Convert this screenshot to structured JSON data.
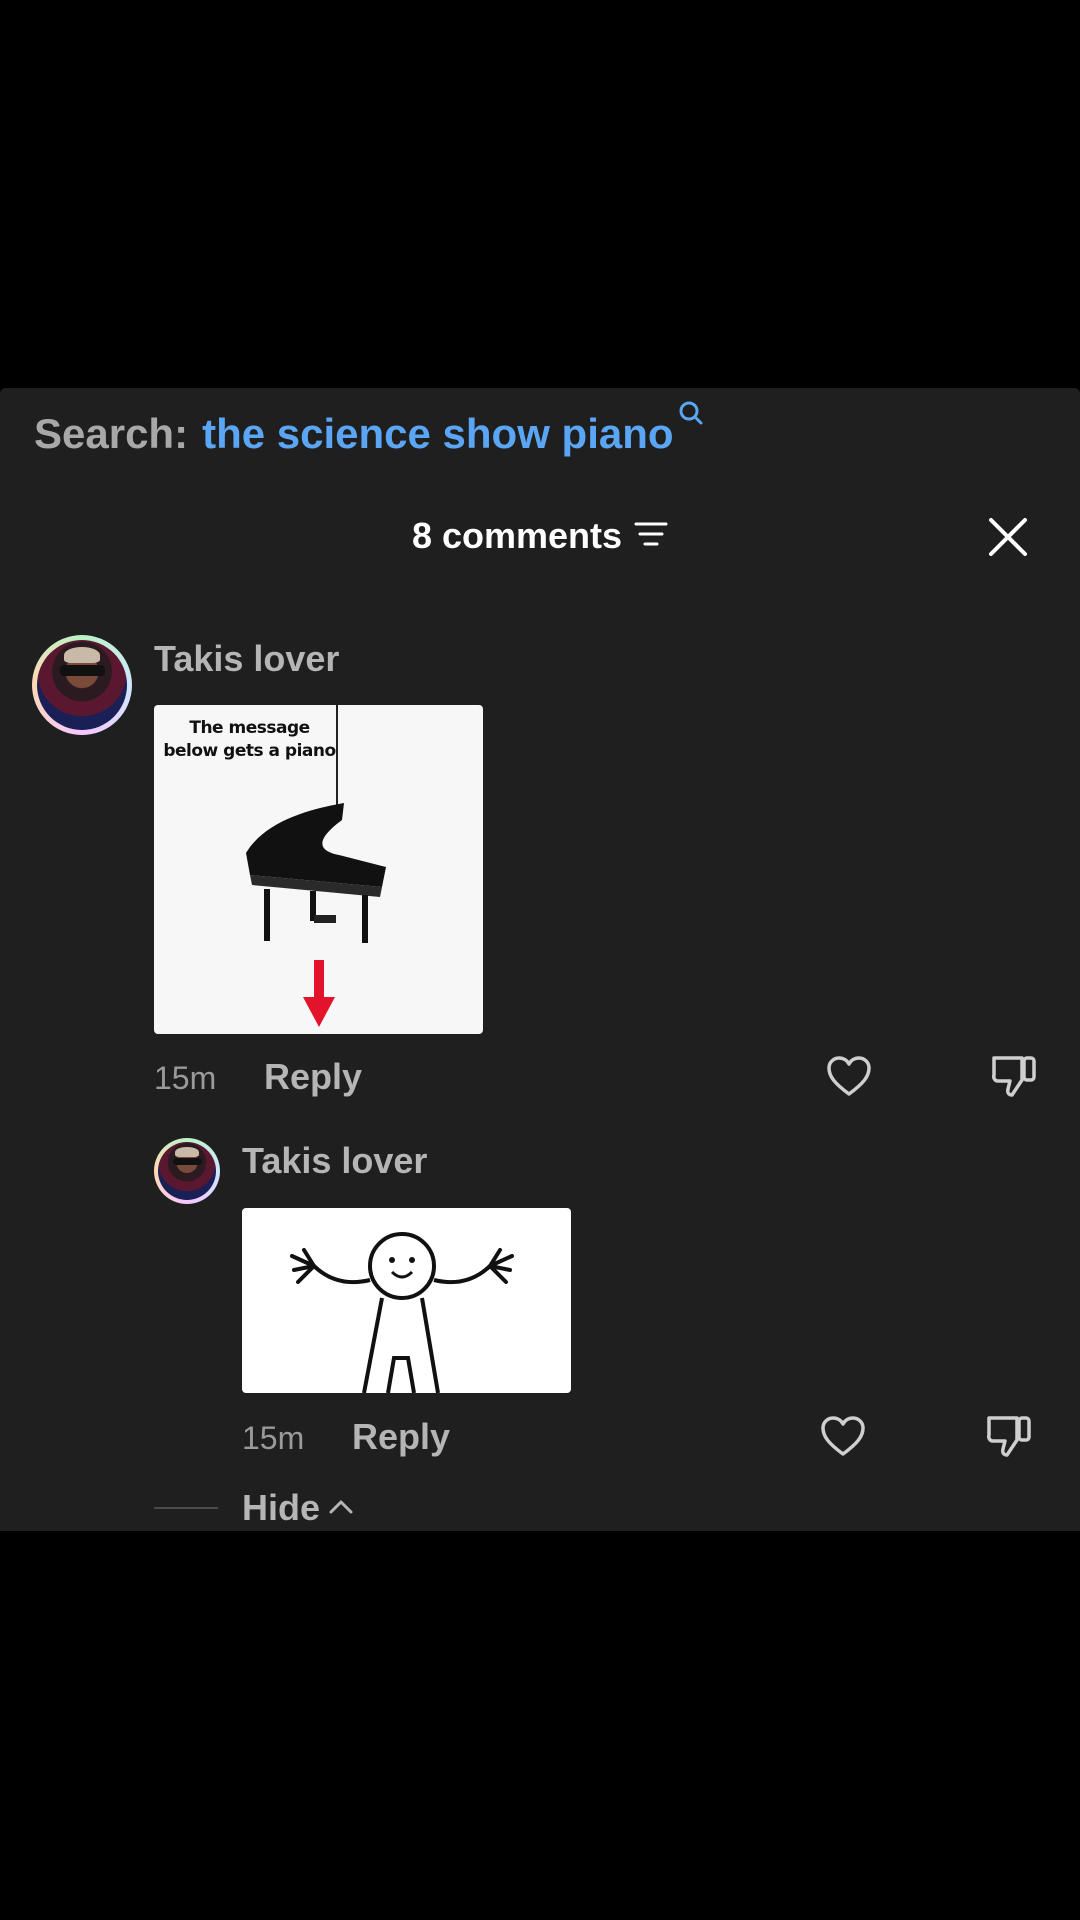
{
  "search": {
    "label": "Search:",
    "term": "the science show piano",
    "icon": "search-icon"
  },
  "header": {
    "count_label": "8 comments",
    "sort_icon": "sort-lines-icon",
    "close_icon": "close-icon"
  },
  "comments": [
    {
      "username": "Takis lover",
      "media_caption": "The message below gets a piano",
      "media_description_icon": "piano-falling-meme",
      "time": "15m",
      "reply_label": "Reply",
      "like_icon": "heart-icon",
      "dislike_icon": "thumbs-down-icon"
    },
    {
      "username": "Takis lover",
      "media_description_icon": "stick-figure-meme",
      "time": "15m",
      "reply_label": "Reply",
      "like_icon": "heart-icon",
      "dislike_icon": "thumbs-down-icon"
    }
  ],
  "replies_toggle": {
    "label": "Hide",
    "icon": "chevron-up-icon"
  },
  "colors": {
    "sheet_bg": "#1f1f1f",
    "search_term": "#5aa6f5",
    "muted_text": "#b5b5b5",
    "accent_arrow": "#e3132b"
  }
}
